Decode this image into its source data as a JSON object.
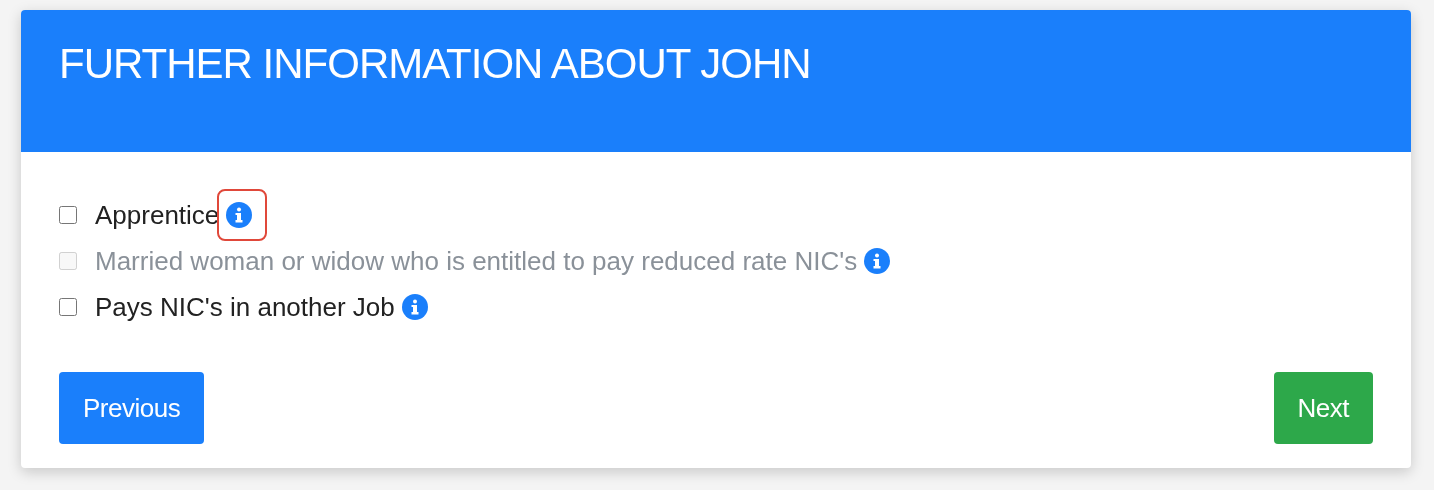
{
  "card": {
    "title": "FURTHER INFORMATION ABOUT JOHN"
  },
  "options": [
    {
      "label": "Apprentice",
      "checked": false,
      "disabled": false,
      "highlighted": true
    },
    {
      "label": "Married woman or widow who is entitled to pay reduced rate NIC's",
      "checked": false,
      "disabled": true,
      "highlighted": false
    },
    {
      "label": "Pays NIC's in another Job",
      "checked": false,
      "disabled": false,
      "highlighted": false
    }
  ],
  "buttons": [
    {
      "label": "Previous",
      "kind": "primary"
    },
    {
      "label": "Next",
      "kind": "success"
    }
  ]
}
